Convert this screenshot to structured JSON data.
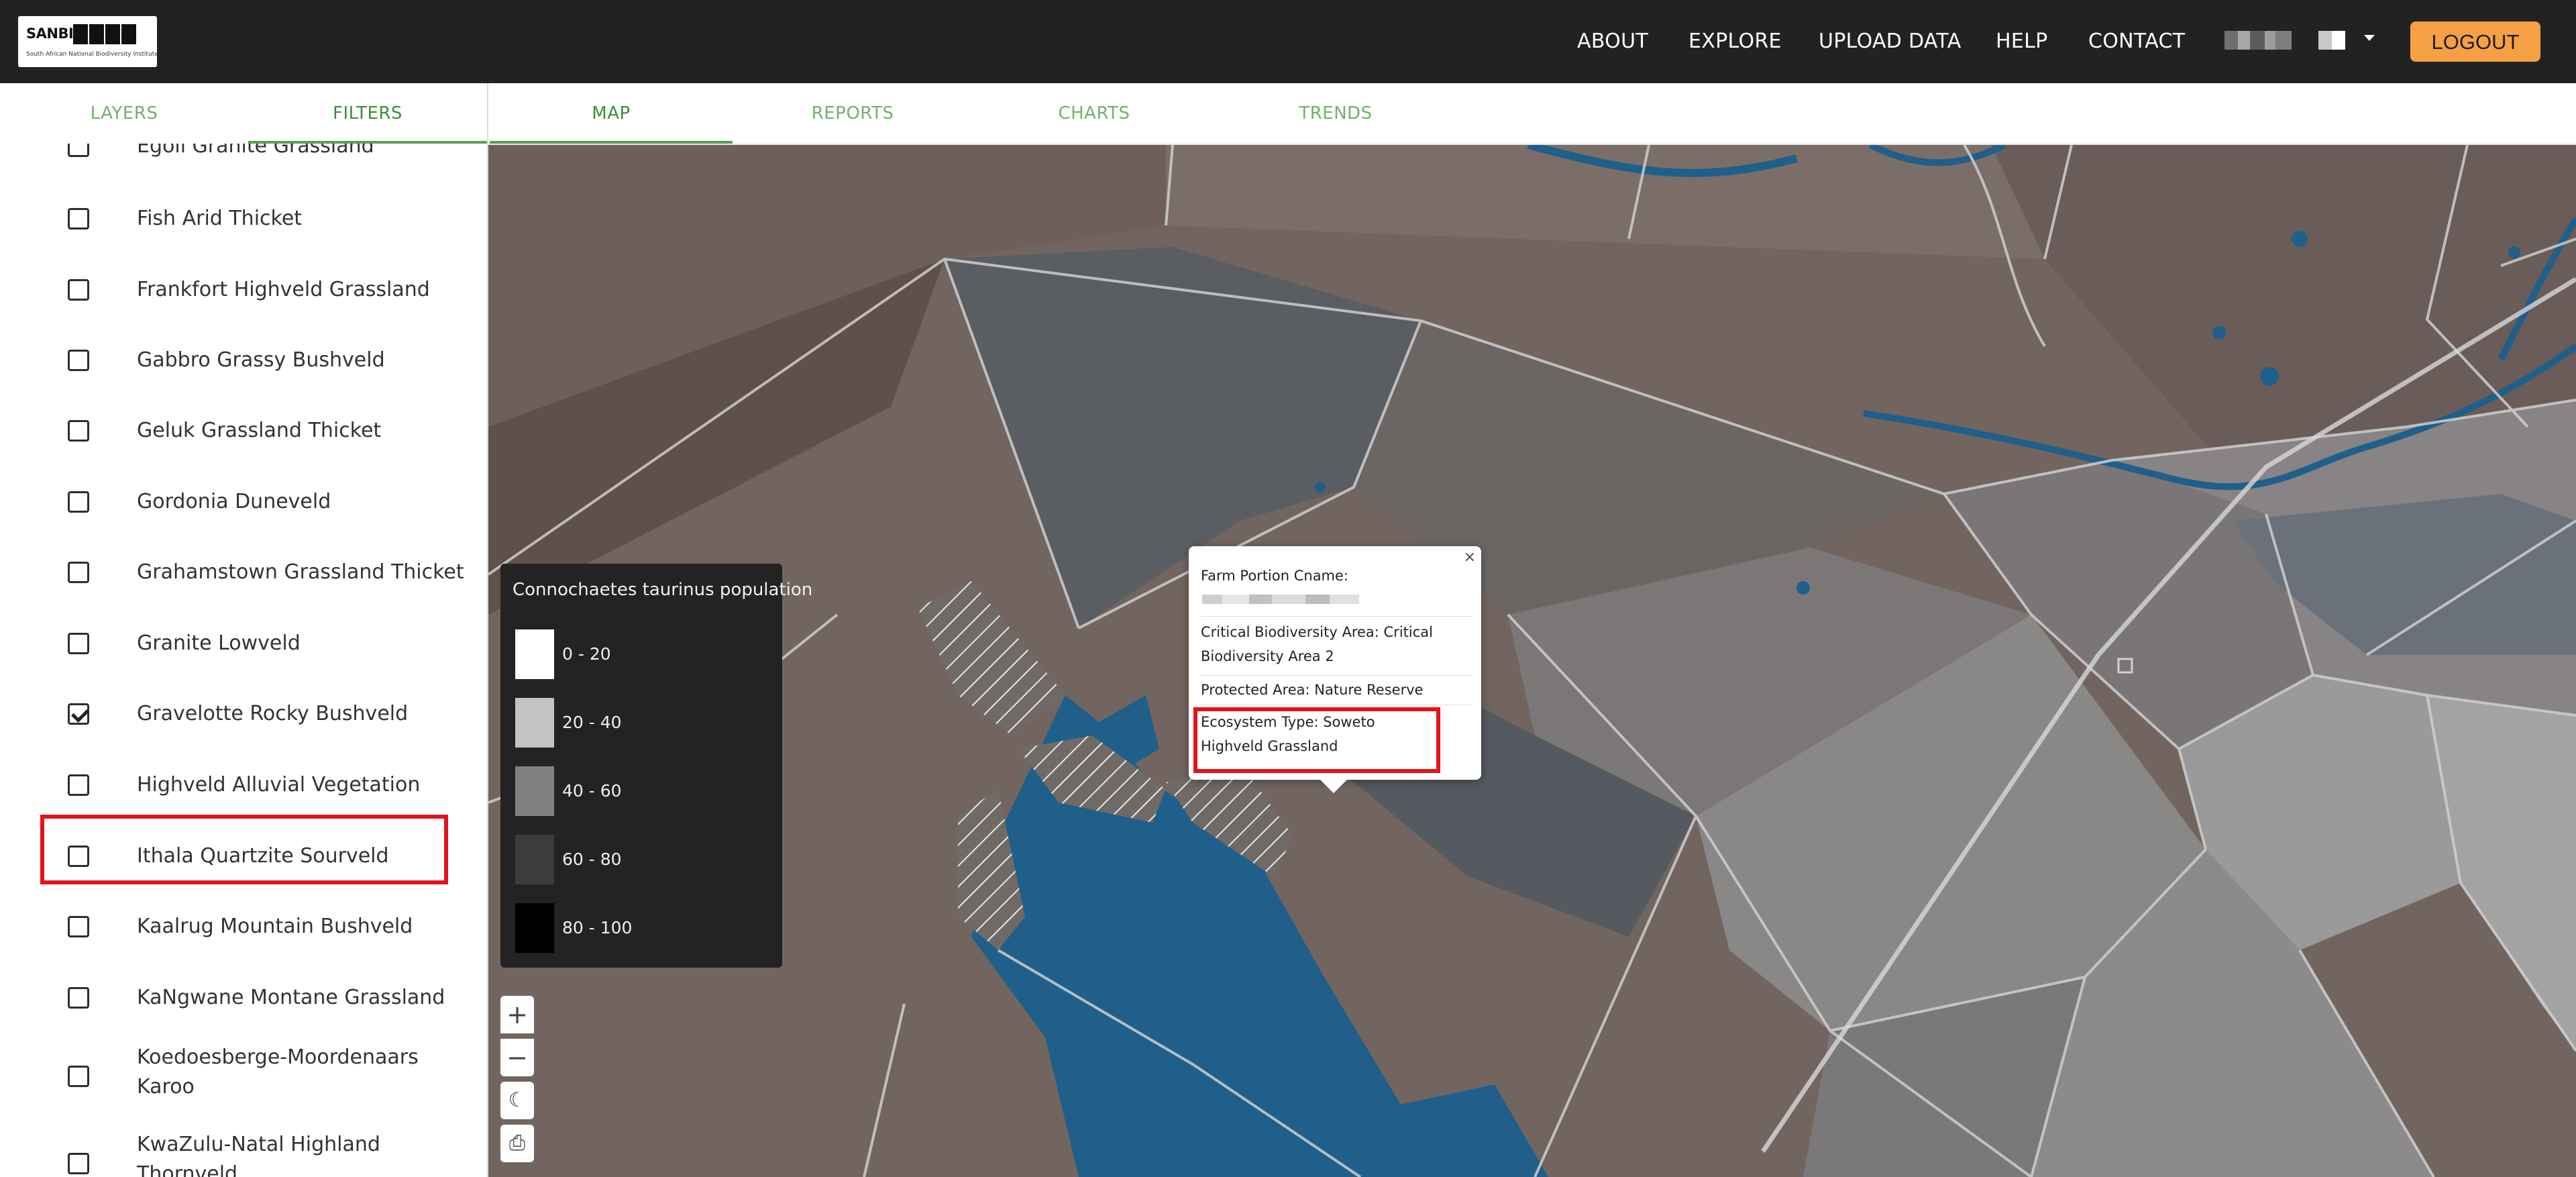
{
  "brand": {
    "name": "SANBI",
    "subtitle": "South African National Biodiversity Institute"
  },
  "nav": {
    "about": "ABOUT",
    "explore": "EXPLORE",
    "upload": "UPLOAD DATA",
    "help": "HELP",
    "contact": "CONTACT",
    "logout": "LOGOUT"
  },
  "left_tabs": {
    "layers": "LAYERS",
    "filters": "FILTERS",
    "active": "FILTERS"
  },
  "main_tabs": {
    "map": "MAP",
    "reports": "REPORTS",
    "charts": "CHARTS",
    "trends": "TRENDS",
    "active": "MAP"
  },
  "filters": {
    "partial_top": "Egoli Granite Grassland",
    "items": [
      {
        "label": "Fish Arid Thicket",
        "checked": false
      },
      {
        "label": "Frankfort Highveld Grassland",
        "checked": false
      },
      {
        "label": "Gabbro Grassy Bushveld",
        "checked": false
      },
      {
        "label": "Geluk Grassland Thicket",
        "checked": false
      },
      {
        "label": "Gordonia Duneveld",
        "checked": false
      },
      {
        "label": "Grahamstown Grassland Thicket",
        "checked": false
      },
      {
        "label": "Granite Lowveld",
        "checked": false
      },
      {
        "label": "Gravelotte Rocky Bushveld",
        "checked": true
      },
      {
        "label": "Highveld Alluvial Vegetation",
        "checked": false
      },
      {
        "label": "Ithala Quartzite Sourveld",
        "checked": false
      },
      {
        "label": "Kaalrug Mountain Bushveld",
        "checked": false
      },
      {
        "label": "KaNgwane Montane Grassland",
        "checked": false
      },
      {
        "label": "Koedoesberge-Moordenaars Karoo",
        "checked": false
      },
      {
        "label": "KwaZulu-Natal Highland Thornveld",
        "checked": false
      }
    ]
  },
  "legend": {
    "title": "Connochaetes taurinus population",
    "items": [
      {
        "label": "0 - 20",
        "color": "#ffffff"
      },
      {
        "label": "20 - 40",
        "color": "#c4c4c4"
      },
      {
        "label": "40 - 60",
        "color": "#808080"
      },
      {
        "label": "60 - 80",
        "color": "#3c3c3c"
      },
      {
        "label": "80 - 100",
        "color": "#000000"
      }
    ]
  },
  "map_controls": {
    "zoom_in": "+",
    "zoom_out": "−",
    "theme": "☾",
    "print": "⎙"
  },
  "popup": {
    "close": "×",
    "farm_portion_label": "Farm Portion Cname:",
    "cba": "Critical Biodiversity Area: Critical Biodiversity Area 2",
    "protected": "Protected Area: Nature Reserve",
    "ecosystem": "Ecosystem Type: Soweto Highveld Grassland"
  },
  "colors": {
    "navbar": "#222222",
    "accent_green": "#55a350",
    "logout_orange": "#f6a044",
    "water_blue": "#1f5f8a",
    "highlight_red": "#e3131b"
  }
}
